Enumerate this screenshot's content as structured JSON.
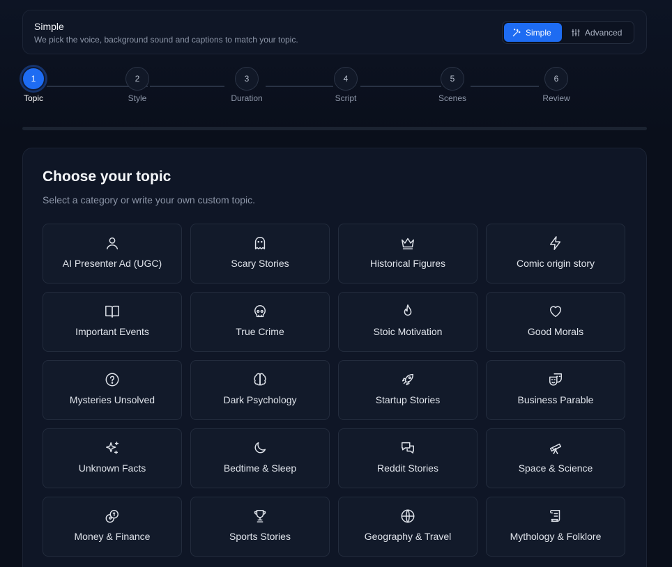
{
  "mode": {
    "title": "Simple",
    "description": "We pick the voice, background sound and captions to match your topic.",
    "simple_label": "Simple",
    "advanced_label": "Advanced",
    "selected": "Simple",
    "accent": "#1e6cf2"
  },
  "steps": [
    {
      "number": "1",
      "label": "Topic",
      "active": true
    },
    {
      "number": "2",
      "label": "Style",
      "active": false
    },
    {
      "number": "3",
      "label": "Duration",
      "active": false
    },
    {
      "number": "4",
      "label": "Script",
      "active": false
    },
    {
      "number": "5",
      "label": "Scenes",
      "active": false
    },
    {
      "number": "6",
      "label": "Review",
      "active": false
    }
  ],
  "topic": {
    "heading": "Choose your topic",
    "subheading": "Select a category or write your own custom topic."
  },
  "categories": [
    {
      "label": "AI Presenter Ad (UGC)",
      "icon": "user-icon"
    },
    {
      "label": "Scary Stories",
      "icon": "ghost-icon"
    },
    {
      "label": "Historical Figures",
      "icon": "crown-icon"
    },
    {
      "label": "Comic origin story",
      "icon": "lightning-icon"
    },
    {
      "label": "Important Events",
      "icon": "book-icon"
    },
    {
      "label": "True Crime",
      "icon": "skull-icon"
    },
    {
      "label": "Stoic Motivation",
      "icon": "flame-icon"
    },
    {
      "label": "Good Morals",
      "icon": "heart-icon"
    },
    {
      "label": "Mysteries Unsolved",
      "icon": "question-icon"
    },
    {
      "label": "Dark Psychology",
      "icon": "brain-icon"
    },
    {
      "label": "Startup Stories",
      "icon": "rocket-icon"
    },
    {
      "label": "Business Parable",
      "icon": "theater-masks-icon"
    },
    {
      "label": "Unknown Facts",
      "icon": "sparkles-icon"
    },
    {
      "label": "Bedtime & Sleep",
      "icon": "moon-icon"
    },
    {
      "label": "Reddit Stories",
      "icon": "chat-bubbles-icon"
    },
    {
      "label": "Space & Science",
      "icon": "telescope-icon"
    },
    {
      "label": "Money & Finance",
      "icon": "coins-icon"
    },
    {
      "label": "Sports Stories",
      "icon": "trophy-icon"
    },
    {
      "label": "Geography & Travel",
      "icon": "globe-icon"
    },
    {
      "label": "Mythology & Folklore",
      "icon": "scroll-icon"
    }
  ]
}
